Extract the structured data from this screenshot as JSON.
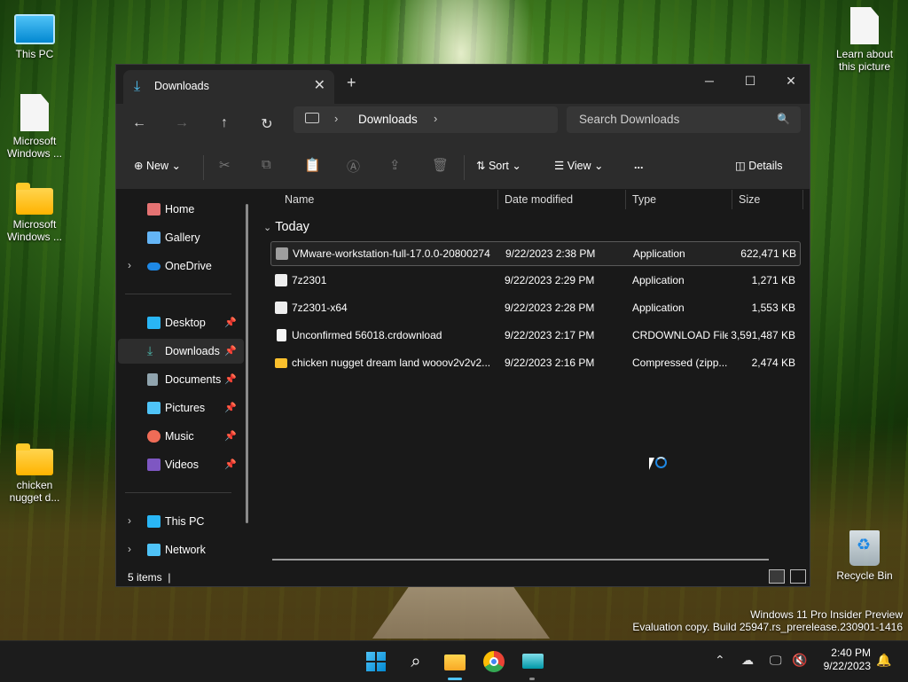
{
  "desktop": {
    "icons_left": [
      {
        "label": "This PC"
      },
      {
        "label": "Microsoft Windows ..."
      },
      {
        "label": "Microsoft Windows ..."
      },
      {
        "label": "chicken nugget d..."
      }
    ],
    "learn_label": "Learn about this picture",
    "recycle_label": "Recycle Bin",
    "watermark_line1": "Windows 11 Pro Insider Preview",
    "watermark_line2": "Evaluation copy. Build 25947.rs_prerelease.230901-1416"
  },
  "window": {
    "tab_title": "Downloads",
    "breadcrumb": "Downloads",
    "search_placeholder": "Search Downloads",
    "toolbar": {
      "new_label": "New",
      "sort_label": "Sort",
      "view_label": "View",
      "more_label": "...",
      "details_label": "Details"
    },
    "sidebar": {
      "items": [
        {
          "label": "Home"
        },
        {
          "label": "Gallery"
        },
        {
          "label": "OneDrive"
        },
        {
          "label": "Desktop"
        },
        {
          "label": "Downloads"
        },
        {
          "label": "Documents"
        },
        {
          "label": "Pictures"
        },
        {
          "label": "Music"
        },
        {
          "label": "Videos"
        },
        {
          "label": "This PC"
        },
        {
          "label": "Network"
        }
      ]
    },
    "columns": {
      "name": "Name",
      "date": "Date modified",
      "type": "Type",
      "size": "Size"
    },
    "group_label": "Today",
    "files": [
      {
        "name": "VMware-workstation-full-17.0.0-20800274",
        "date": "9/22/2023 2:38 PM",
        "type": "Application",
        "size": "622,471 KB"
      },
      {
        "name": "7z2301",
        "date": "9/22/2023 2:29 PM",
        "type": "Application",
        "size": "1,271 KB"
      },
      {
        "name": "7z2301-x64",
        "date": "9/22/2023 2:28 PM",
        "type": "Application",
        "size": "1,553 KB"
      },
      {
        "name": "Unconfirmed 56018.crdownload",
        "date": "9/22/2023 2:17 PM",
        "type": "CRDOWNLOAD File",
        "size": "3,591,487 KB"
      },
      {
        "name": "chicken nugget dream land wooov2v2v2...",
        "date": "9/22/2023 2:16 PM",
        "type": "Compressed (zipp...",
        "size": "2,474 KB"
      }
    ],
    "status_items": "5 items"
  },
  "taskbar": {
    "time": "2:40 PM",
    "date": "9/22/2023"
  },
  "colors": {
    "accent": "#4fc3f7",
    "window_bg": "#191919",
    "bar_bg": "#2c2c2c"
  }
}
